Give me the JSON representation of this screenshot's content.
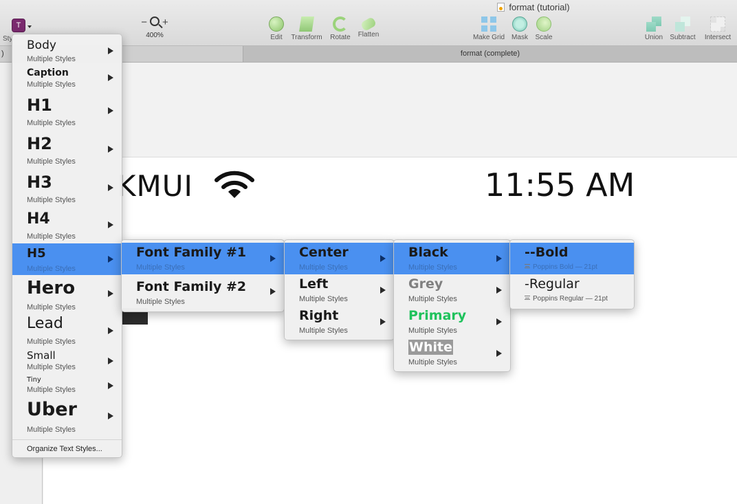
{
  "window": {
    "title": "format (tutorial)"
  },
  "toolbar": {
    "styles_label": "Sty",
    "styles_button_glyph": "T",
    "zoom": {
      "minus": "−",
      "plus": "+",
      "value": "400%"
    },
    "tools": [
      {
        "label": "Edit",
        "icon": "edit-icon"
      },
      {
        "label": "Transform",
        "icon": "transform-icon"
      },
      {
        "label": "Rotate",
        "icon": "rotate-icon"
      },
      {
        "label": "Flatten",
        "icon": "flatten-icon"
      },
      {
        "label": "Make Grid",
        "icon": "make-grid-icon"
      },
      {
        "label": "Mask",
        "icon": "mask-icon"
      },
      {
        "label": "Scale",
        "icon": "scale-icon"
      },
      {
        "label": "Union",
        "icon": "union-icon"
      },
      {
        "label": "Subtract",
        "icon": "subtract-icon"
      },
      {
        "label": "Intersect",
        "icon": "intersect-icon"
      }
    ]
  },
  "tabs": {
    "left": ")",
    "right": "format (complete)"
  },
  "canvas": {
    "carrier": "KMUI",
    "time": "11:55 AM"
  },
  "style_menu": {
    "items": [
      {
        "title": "Body",
        "subtitle": "Multiple Styles"
      },
      {
        "title": "Caption",
        "subtitle": "Multiple Styles"
      },
      {
        "title": "H1",
        "subtitle": "Multiple Styles"
      },
      {
        "title": "H2",
        "subtitle": "Multiple Styles"
      },
      {
        "title": "H3",
        "subtitle": "Multiple Styles"
      },
      {
        "title": "H4",
        "subtitle": "Multiple Styles"
      },
      {
        "title": "H5",
        "subtitle": "Multiple Styles"
      },
      {
        "title": "Hero",
        "subtitle": "Multiple Styles"
      },
      {
        "title": "Lead",
        "subtitle": "Multiple Styles"
      },
      {
        "title": "Small",
        "subtitle": "Multiple Styles"
      },
      {
        "title": "Tiny",
        "subtitle": "Multiple Styles"
      },
      {
        "title": "Uber",
        "subtitle": "Multiple Styles"
      }
    ],
    "organize": "Organize Text Styles..."
  },
  "font_family_menu": {
    "items": [
      {
        "title": "Font Family #1",
        "subtitle": "Multiple Styles"
      },
      {
        "title": "Font Family #2",
        "subtitle": "Multiple Styles"
      }
    ]
  },
  "alignment_menu": {
    "items": [
      {
        "title": "Center",
        "subtitle": "Multiple Styles"
      },
      {
        "title": "Left",
        "subtitle": "Multiple Styles"
      },
      {
        "title": "Right",
        "subtitle": "Multiple Styles"
      }
    ]
  },
  "color_menu": {
    "items": [
      {
        "title": "Black",
        "subtitle": "Multiple Styles",
        "color": "#1a1a1a"
      },
      {
        "title": "Grey",
        "subtitle": "Multiple Styles",
        "color": "#808080"
      },
      {
        "title": "Primary",
        "subtitle": "Multiple Styles",
        "color": "#1fc25c"
      },
      {
        "title": "White",
        "subtitle": "Multiple Styles",
        "color": "#ffffff"
      }
    ]
  },
  "weight_menu": {
    "items": [
      {
        "title": "--Bold",
        "subtitle": "Poppins Bold — 21pt"
      },
      {
        "title": "-Regular",
        "subtitle": "Poppins Regular — 21pt"
      }
    ]
  },
  "colors": {
    "highlight": "#4a90f0",
    "accent_primary": "#1fc25c"
  }
}
